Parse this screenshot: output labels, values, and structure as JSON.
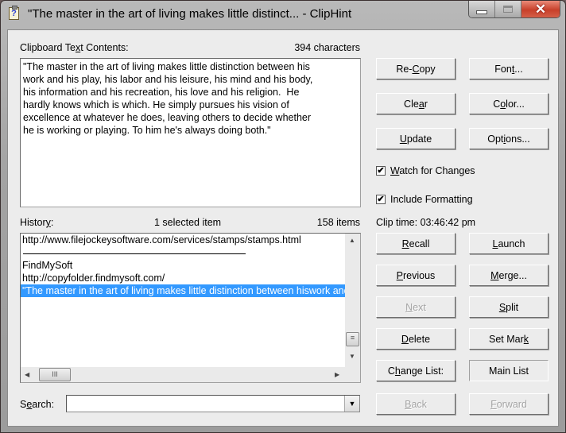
{
  "window": {
    "title": "\"The master in the art of living makes little distinct... - ClipHint",
    "icon": "clipboard-question-icon",
    "controls": {
      "minimize": "minimize-icon",
      "maximize": "maximize-icon",
      "close": "✕"
    }
  },
  "clipboard": {
    "label_pre": "Clipboard Te",
    "label_u": "x",
    "label_post": "t Contents:",
    "char_count": "394 characters",
    "text": "\"The master in the art of living makes little distinction between his\nwork and his play, his labor and his leisure, his mind and his body,\nhis information and his recreation, his love and his religion.  He\nhardly knows which is which. He simply pursues his vision of\nexcellence at whatever he does, leaving others to decide whether\nhe is working or playing. To him he's always doing both.\""
  },
  "buttons": {
    "recopy": {
      "pre": "Re-",
      "u": "C",
      "post": "opy"
    },
    "font": {
      "pre": "Fon",
      "u": "t",
      "post": "..."
    },
    "clear": {
      "pre": "Cle",
      "u": "a",
      "post": "r"
    },
    "color": {
      "pre": "C",
      "u": "o",
      "post": "lor..."
    },
    "update": {
      "pre": "",
      "u": "U",
      "post": "pdate"
    },
    "options": {
      "pre": "Opt",
      "u": "i",
      "post": "ons..."
    },
    "recall": {
      "pre": "",
      "u": "R",
      "post": "ecall"
    },
    "launch": {
      "pre": "",
      "u": "L",
      "post": "aunch"
    },
    "previous": {
      "pre": "",
      "u": "P",
      "post": "revious"
    },
    "merge": {
      "pre": "",
      "u": "M",
      "post": "erge..."
    },
    "next": {
      "pre": "",
      "u": "N",
      "post": "ext"
    },
    "split": {
      "pre": "",
      "u": "S",
      "post": "plit"
    },
    "delete": {
      "pre": "",
      "u": "D",
      "post": "elete"
    },
    "setmark": {
      "pre": "Set Mar",
      "u": "k",
      "post": ""
    },
    "changelist": {
      "pre": "C",
      "u": "h",
      "post": "ange List:"
    },
    "mainlist": "Main List",
    "back": {
      "pre": "",
      "u": "B",
      "post": "ack"
    },
    "forward": {
      "pre": "",
      "u": "F",
      "post": "orward"
    }
  },
  "options": {
    "watch": {
      "pre": "",
      "u": "W",
      "post": "atch for Changes",
      "checked": true,
      "mark": "✔"
    },
    "formatting": {
      "pre": "Include Formattin",
      "u": "g",
      "post": "",
      "checked": true,
      "mark": "✔"
    }
  },
  "clip_time": "Clip time: 03:46:42 pm",
  "history": {
    "label_pre": "Histor",
    "label_u": "y",
    "label_post": ":",
    "selected_count": "1 selected item",
    "item_count": "158 items",
    "items": [
      {
        "text": "http://www.filejockeysoftware.com/services/stamps/stamps.html",
        "type": "normal"
      },
      {
        "text": "",
        "type": "separator"
      },
      {
        "text": "FindMySoft",
        "type": "normal"
      },
      {
        "text": "http://copyfolder.findmysoft.com/",
        "type": "normal"
      },
      {
        "text": "\"The master in the art of living makes little distinction between hiswork and his play",
        "type": "selected"
      }
    ],
    "scroll": {
      "up": "▲",
      "down": "▼",
      "left": "◀",
      "right": "▶",
      "grip": "≡",
      "hgrip": "III"
    }
  },
  "search": {
    "label_pre": "S",
    "label_u": "e",
    "label_post": "arch:",
    "value": "",
    "placeholder": "",
    "dropdown": "▼"
  }
}
